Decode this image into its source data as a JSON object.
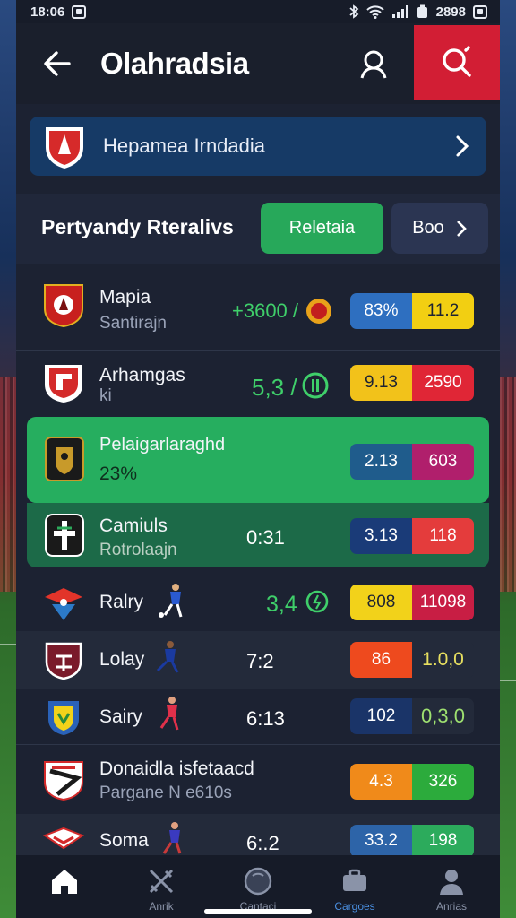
{
  "status": {
    "time": "18:06",
    "battery": "2898"
  },
  "header": {
    "title": "Olahradsia"
  },
  "banner": {
    "label": "Hepamea Irndadia"
  },
  "section": {
    "title": "Pertyandy Rteralivs",
    "primary_label": "Reletaia",
    "secondary_label": "Boo"
  },
  "matches": [
    {
      "name": "Mapia",
      "sub": "Santirajn",
      "score": "+3600 /",
      "score_color": "#3fcf6a",
      "odds": [
        "83%",
        "11.2"
      ],
      "odds_colors": [
        "#2e6fc0",
        "#f2cf12"
      ],
      "odds_text": [
        "#ffffff",
        "#1c2232"
      ]
    },
    {
      "name": "Arhamgas",
      "sub": "ki",
      "score": "5,3 /",
      "score_color": "#3fcf6a",
      "odds": [
        "9.13",
        "2590"
      ],
      "odds_colors": [
        "#f2c21a",
        "#e02636"
      ],
      "odds_text": [
        "#1c2232",
        "#ffffff"
      ]
    },
    {
      "name": "Pelaigarlaraghd",
      "sub": "23%",
      "score": "",
      "odds": [
        "2.13",
        "603"
      ],
      "odds_colors": [
        "#1f5c8c",
        "#b01f6c"
      ],
      "odds_text": [
        "#ffffff",
        "#ffffff"
      ]
    },
    {
      "name": "Camiuls",
      "sub": "Rotrolaajn",
      "score": "0:31",
      "score_color": "#ffffff",
      "odds": [
        "3.13",
        "118"
      ],
      "odds_colors": [
        "#1a3b78",
        "#e43c3c"
      ],
      "odds_text": [
        "#ffffff",
        "#ffffff"
      ]
    },
    {
      "name": "Ralry",
      "sub": "",
      "score": "3,4",
      "score_color": "#3fcf6a",
      "odds": [
        "808",
        "11098"
      ],
      "odds_colors": [
        "#f2d21a",
        "#c81e44"
      ],
      "odds_text": [
        "#1c2232",
        "#ffffff"
      ]
    },
    {
      "name": "Lolay",
      "sub": "",
      "score": "7:2",
      "score_color": "#ffffff",
      "odds": [
        "86",
        "1.0,0"
      ],
      "odds_colors": [
        "#ee4a1e",
        "#232a3a"
      ],
      "odds_text": [
        "#ffffff",
        "#e8e060"
      ]
    },
    {
      "name": "Sairy",
      "sub": "",
      "score": "6:13",
      "score_color": "#ffffff",
      "odds": [
        "102",
        "0,3,0"
      ],
      "odds_colors": [
        "#1a3468",
        "#232a3a"
      ],
      "odds_text": [
        "#ffffff",
        "#9ee070"
      ]
    },
    {
      "name": "Donaidla isfetaacd",
      "sub": "Pargane N e610s",
      "score": "",
      "odds": [
        "4.3",
        "326"
      ],
      "odds_colors": [
        "#f08a1a",
        "#2cab3c"
      ],
      "odds_text": [
        "#ffffff",
        "#ffffff"
      ]
    },
    {
      "name": "Soma",
      "sub": "",
      "score": "6:.2",
      "score_color": "#ffffff",
      "odds": [
        "33.2",
        "198"
      ],
      "odds_colors": [
        "#2d64a8",
        "#2cab5c"
      ],
      "odds_text": [
        "#ffffff",
        "#ffffff"
      ]
    }
  ],
  "nav": [
    {
      "label": "",
      "icon": "home-icon"
    },
    {
      "label": "Anrik",
      "icon": "swords-icon"
    },
    {
      "label": "Cantaci",
      "icon": "ball-icon"
    },
    {
      "label": "Cargoes",
      "icon": "briefcase-icon"
    },
    {
      "label": "Anrias",
      "icon": "user-icon"
    }
  ]
}
